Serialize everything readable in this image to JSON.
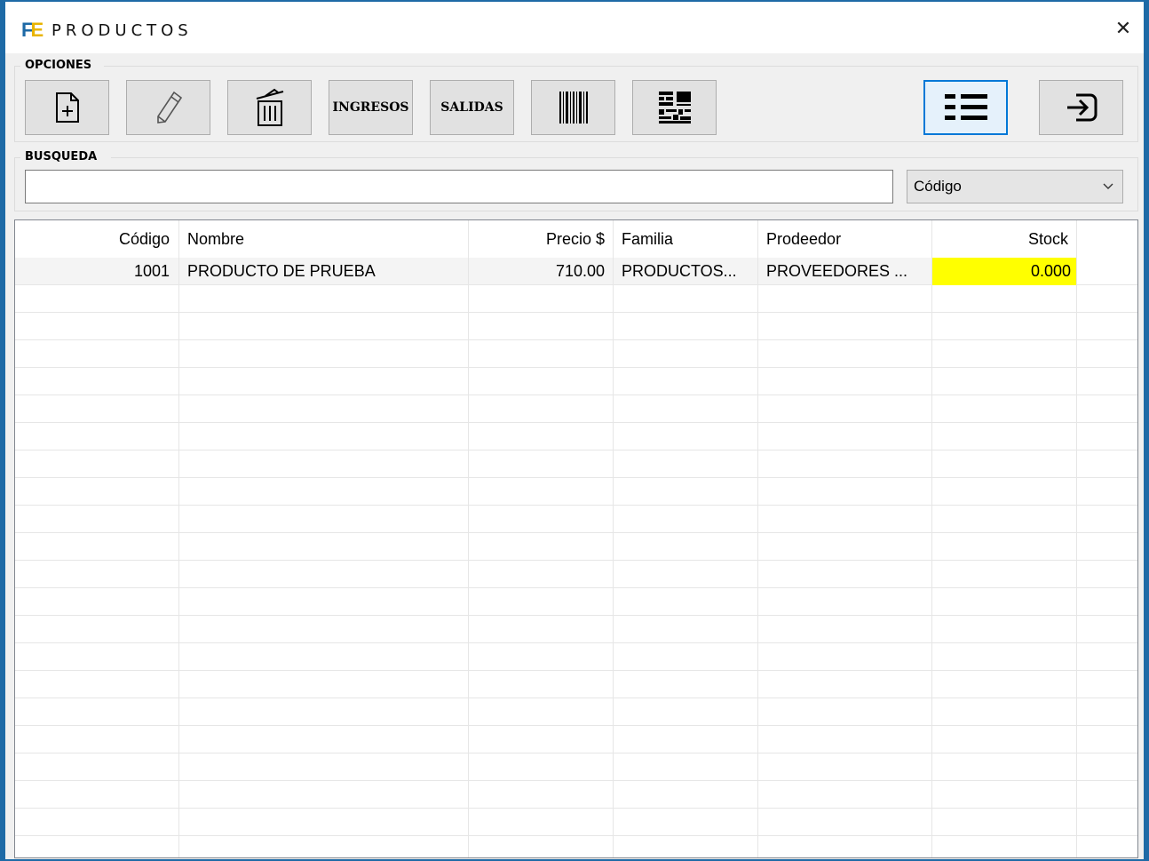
{
  "window": {
    "title": "PRODUCTOS",
    "logo_f": "F",
    "logo_e": "E",
    "close_glyph": "✕"
  },
  "opciones": {
    "label": "OPCIONES",
    "buttons": {
      "new": "new-document-icon",
      "edit": "pencil-icon",
      "delete": "trash-icon",
      "ingresos": "INGRESOS",
      "salidas": "SALIDAS",
      "barcode": "barcode-icon",
      "qrcode": "qr-code-icon",
      "list": "list-icon",
      "exit": "exit-icon"
    }
  },
  "busqueda": {
    "label": "BUSQUEDA",
    "value": "",
    "filter_selected": "Código"
  },
  "table": {
    "columns": [
      "Código",
      "Nombre",
      "Precio $",
      "Familia",
      "Prodeedor",
      "Stock"
    ],
    "rows": [
      {
        "codigo": "1001",
        "nombre": "PRODUCTO DE PRUEBA",
        "precio": "710.00",
        "familia": "PRODUCTOS...",
        "proveedor": "PROVEEDORES ...",
        "stock": "0.000"
      }
    ]
  },
  "colors": {
    "window_border": "#1e6aa6",
    "stock_highlight": "#ffff00",
    "active_button": "#0078d7"
  }
}
